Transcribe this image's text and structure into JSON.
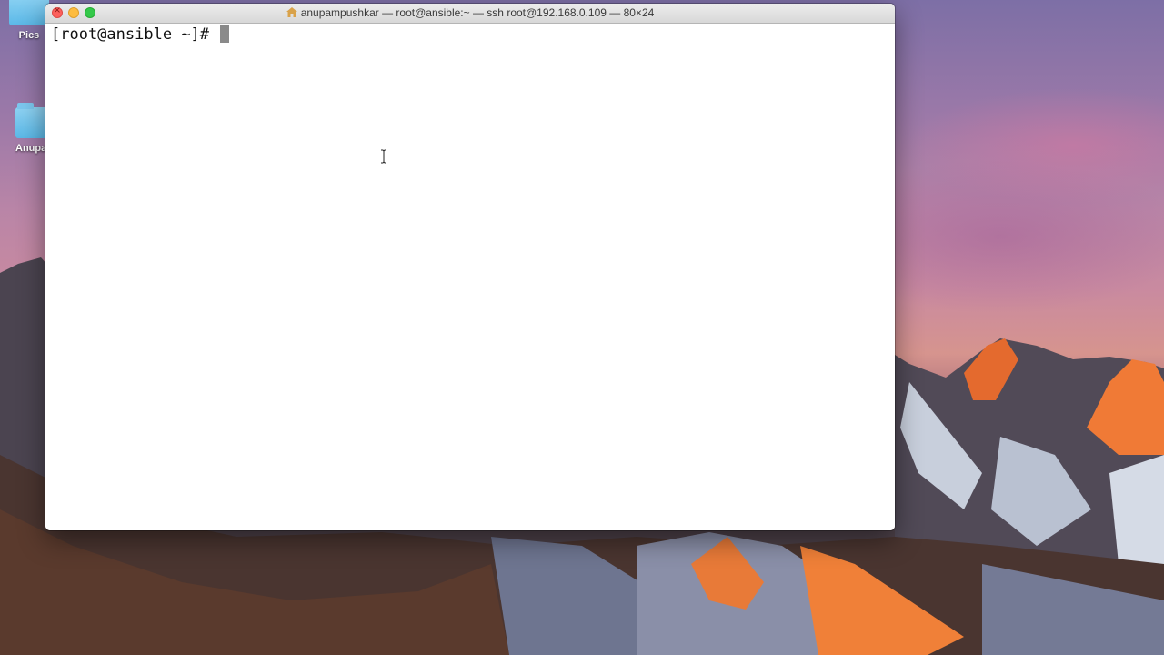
{
  "desktop": {
    "icons": [
      {
        "label": "Pics",
        "icon": "folder-icon"
      },
      {
        "label": "Anupam",
        "icon": "folder-icon"
      }
    ]
  },
  "window": {
    "title": "anupampushkar — root@ansible:~ — ssh root@192.168.0.109 — 80×24",
    "title_icon": "home-icon",
    "buttons": [
      "close",
      "minimize",
      "zoom"
    ],
    "colors": {
      "close": "#fc605c",
      "minimize": "#fdbc40",
      "zoom": "#34c84a"
    }
  },
  "terminal": {
    "prompt": "[root@ansible ~]# "
  }
}
